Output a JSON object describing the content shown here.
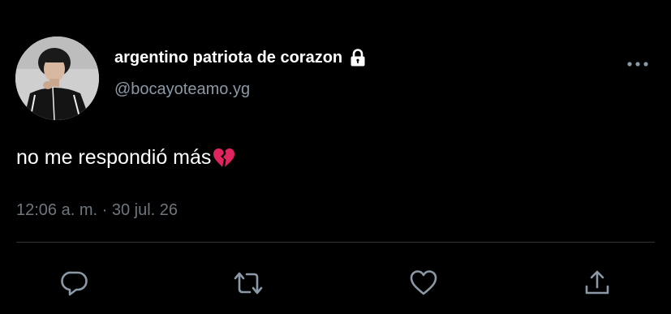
{
  "tweet": {
    "author": {
      "display_name": "argentino patriota de corazon",
      "handle": "@bocayoteamo.yg",
      "avatar_icon": "profile-photo",
      "protected_icon": "lock-icon"
    },
    "text": "no me respondió más",
    "text_emoji": "broken-heart-icon",
    "timestamp": "12:06 a. m. · 30 jul. 26",
    "more_icon": "more-options-icon"
  },
  "actions": [
    {
      "name": "reply",
      "icon": "reply-icon"
    },
    {
      "name": "retweet",
      "icon": "retweet-icon"
    },
    {
      "name": "like",
      "icon": "heart-icon"
    },
    {
      "name": "share",
      "icon": "share-icon"
    }
  ],
  "colors": {
    "background": "#000000",
    "primary_text": "#ffffff",
    "secondary_text": "#8b98a5",
    "timestamp_text": "#6e767d",
    "divider": "#2f3336",
    "icon": "#8b98a5",
    "broken_heart": "#e0245e"
  }
}
